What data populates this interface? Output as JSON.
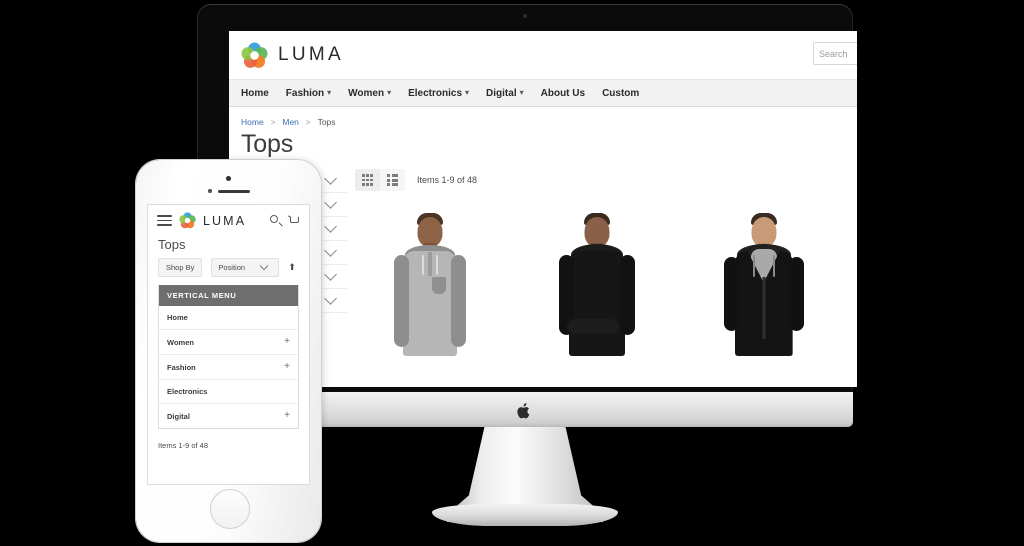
{
  "brand": {
    "name": "LUMA",
    "logo_icon": "luma-flower-logo",
    "colors": {
      "blue": "#3aa0dc",
      "green": "#5cb85c",
      "lime": "#8cc63f",
      "yellow": "#f0c419",
      "orange": "#ef7d27",
      "red_orange": "#e8603c"
    }
  },
  "desktop": {
    "device": "imac",
    "search": {
      "value": "",
      "placeholder": "Search"
    },
    "nav": [
      {
        "label": "Home",
        "caret": false
      },
      {
        "label": "Fashion",
        "caret": true
      },
      {
        "label": "Women",
        "caret": true
      },
      {
        "label": "Electronics",
        "caret": true
      },
      {
        "label": "Digital",
        "caret": true
      },
      {
        "label": "About Us",
        "caret": false
      },
      {
        "label": "Custom",
        "caret": false
      }
    ],
    "breadcrumb": [
      {
        "label": "Home",
        "link": true
      },
      {
        "label": "Men",
        "link": true
      },
      {
        "label": "Tops",
        "link": false
      }
    ],
    "breadcrumb_separator": ">",
    "page_title": "Tops",
    "toolbar": {
      "grid_view_icon": "grid-view-icon",
      "list_view_icon": "list-view-icon",
      "count": "Items 1-9 of 48"
    },
    "sidebar_filters": [
      {
        "chevron": "chevron-down-icon"
      },
      {
        "chevron": "chevron-down-icon"
      },
      {
        "chevron": "chevron-down-icon"
      },
      {
        "chevron": "chevron-down-icon"
      },
      {
        "chevron": "chevron-down-icon"
      },
      {
        "chevron": "chevron-down-icon"
      }
    ],
    "products": [
      {
        "name": "gray-hoodie-model",
        "garment": "gray",
        "alt": "Man wearing gray hooded henley top"
      },
      {
        "name": "black-hoodie-model",
        "garment": "black",
        "alt": "Man wearing black hoodie with arms crossed"
      },
      {
        "name": "black-zip-hoodie-model",
        "garment": "black-zip",
        "alt": "Man wearing black zip hoodie over gray tee"
      }
    ]
  },
  "mobile": {
    "device": "iphone",
    "header": {
      "menu_icon": "hamburger-menu-icon",
      "brand": "LUMA",
      "search_icon": "search-icon",
      "cart_icon": "cart-icon"
    },
    "page_title": "Tops",
    "controls": {
      "shop_by": "Shop By",
      "sort_value": "Position",
      "sort_caret_icon": "chevron-down-icon",
      "sort_direction_icon": "sort-ascending-icon",
      "sort_direction_glyph": "⬆"
    },
    "vertical_menu": {
      "heading": "VERTICAL MENU",
      "items": [
        {
          "label": "Home",
          "expandable": false,
          "glyph": ""
        },
        {
          "label": "Women",
          "expandable": true,
          "glyph": "+"
        },
        {
          "label": "Fashion",
          "expandable": true,
          "glyph": "+"
        },
        {
          "label": "Electronics",
          "expandable": false,
          "glyph": ""
        },
        {
          "label": "Digital",
          "expandable": true,
          "glyph": "+"
        }
      ]
    },
    "count": "Items 1-9 of 48"
  }
}
